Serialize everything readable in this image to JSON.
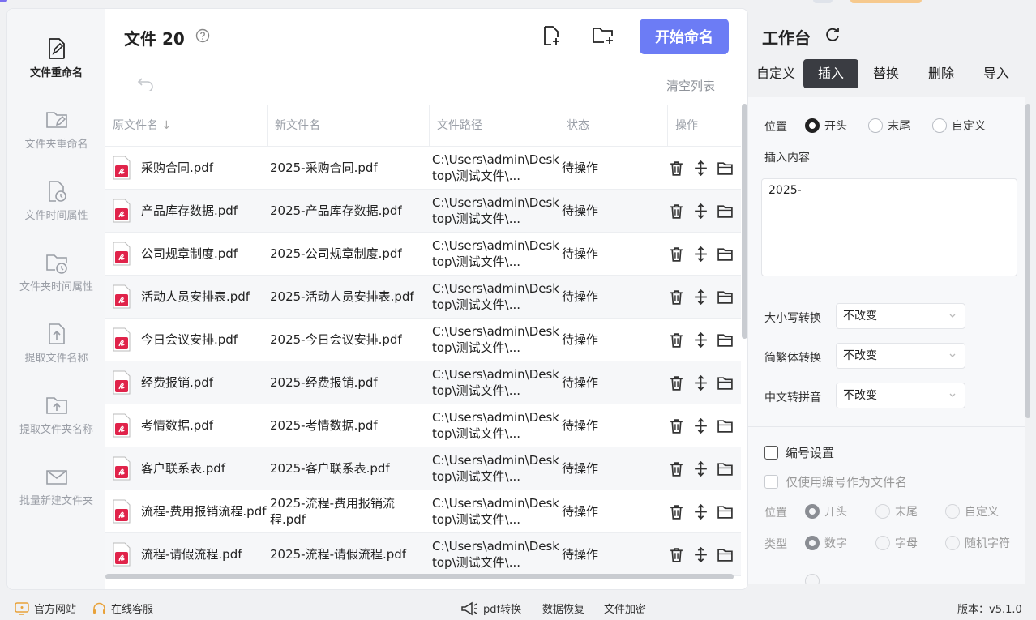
{
  "colors": {
    "accent": "#6c7cf5",
    "pdf_icon": "#e0234a",
    "active_tab": "#3a3c42"
  },
  "sidebar": {
    "items": [
      {
        "label": "文件重命名",
        "icon": "file-edit-icon",
        "active": true
      },
      {
        "label": "文件夹重命名",
        "icon": "folder-edit-icon",
        "active": false
      },
      {
        "label": "文件时间属性",
        "icon": "file-clock-icon",
        "active": false
      },
      {
        "label": "文件夹时间属性",
        "icon": "folder-clock-icon",
        "active": false
      },
      {
        "label": "提取文件名称",
        "icon": "file-upload-icon",
        "active": false
      },
      {
        "label": "提取文件夹名称",
        "icon": "folder-upload-icon",
        "active": false
      },
      {
        "label": "批量新建文件夹",
        "icon": "mail-folder-icon",
        "active": false
      }
    ]
  },
  "header": {
    "title": "文件 20",
    "start_button": "开始命名",
    "clear_list": "清空列表",
    "icons": [
      "help-icon",
      "add-file-icon",
      "add-folder-icon",
      "undo-icon"
    ]
  },
  "table": {
    "columns": [
      "原文件名",
      "新文件名",
      "文件路径",
      "状态",
      "操作"
    ],
    "rows": [
      {
        "original": "采购合同.pdf",
        "new": "2025-采购合同.pdf",
        "path": "C:\\Users\\admin\\Desktop\\测试文件\\...",
        "status": "待操作"
      },
      {
        "original": "产品库存数据.pdf",
        "new": "2025-产品库存数据.pdf",
        "path": "C:\\Users\\admin\\Desktop\\测试文件\\...",
        "status": "待操作"
      },
      {
        "original": "公司规章制度.pdf",
        "new": "2025-公司规章制度.pdf",
        "path": "C:\\Users\\admin\\Desktop\\测试文件\\...",
        "status": "待操作"
      },
      {
        "original": "活动人员安排表.pdf",
        "new": "2025-活动人员安排表.pdf",
        "path": "C:\\Users\\admin\\Desktop\\测试文件\\...",
        "status": "待操作"
      },
      {
        "original": "今日会议安排.pdf",
        "new": "2025-今日会议安排.pdf",
        "path": "C:\\Users\\admin\\Desktop\\测试文件\\...",
        "status": "待操作"
      },
      {
        "original": "经费报销.pdf",
        "new": "2025-经费报销.pdf",
        "path": "C:\\Users\\admin\\Desktop\\测试文件\\...",
        "status": "待操作"
      },
      {
        "original": "考情数据.pdf",
        "new": "2025-考情数据.pdf",
        "path": "C:\\Users\\admin\\Desktop\\测试文件\\...",
        "status": "待操作"
      },
      {
        "original": "客户联系表.pdf",
        "new": "2025-客户联系表.pdf",
        "path": "C:\\Users\\admin\\Desktop\\测试文件\\...",
        "status": "待操作"
      },
      {
        "original": "流程-费用报销流程.pdf",
        "new": "2025-流程-费用报销流程.pdf",
        "path": "C:\\Users\\admin\\Desktop\\测试文件\\...",
        "status": "待操作"
      },
      {
        "original": "流程-请假流程.pdf",
        "new": "2025-流程-请假流程.pdf",
        "path": "C:\\Users\\admin\\Desktop\\测试文件\\...",
        "status": "待操作"
      }
    ]
  },
  "workspace": {
    "title": "工作台",
    "tabs": [
      "自定义",
      "插入",
      "替换",
      "删除",
      "导入"
    ],
    "active_tab": "插入",
    "position_label": "位置",
    "position_options": [
      "开头",
      "末尾",
      "自定义"
    ],
    "position_selected": "开头",
    "insert_label": "插入内容",
    "insert_value": "2025-",
    "case_label": "大小写转换",
    "case_value": "不改变",
    "trad_label": "简繁体转换",
    "trad_value": "不改变",
    "pinyin_label": "中文转拼音",
    "pinyin_value": "不改变",
    "numbering_label": "编号设置",
    "only_numbering_label": "仅使用编号作为文件名",
    "num_position_label": "位置",
    "num_position_options": [
      "开头",
      "末尾",
      "自定义"
    ],
    "num_type_label": "类型",
    "num_type_options": [
      "数字",
      "字母",
      "随机字符"
    ]
  },
  "footer": {
    "website": "官方网站",
    "support": "在线客服",
    "pdf_convert": "pdf转换",
    "data_recovery": "数据恢复",
    "file_encrypt": "文件加密",
    "version": "版本：v5.1.0"
  }
}
